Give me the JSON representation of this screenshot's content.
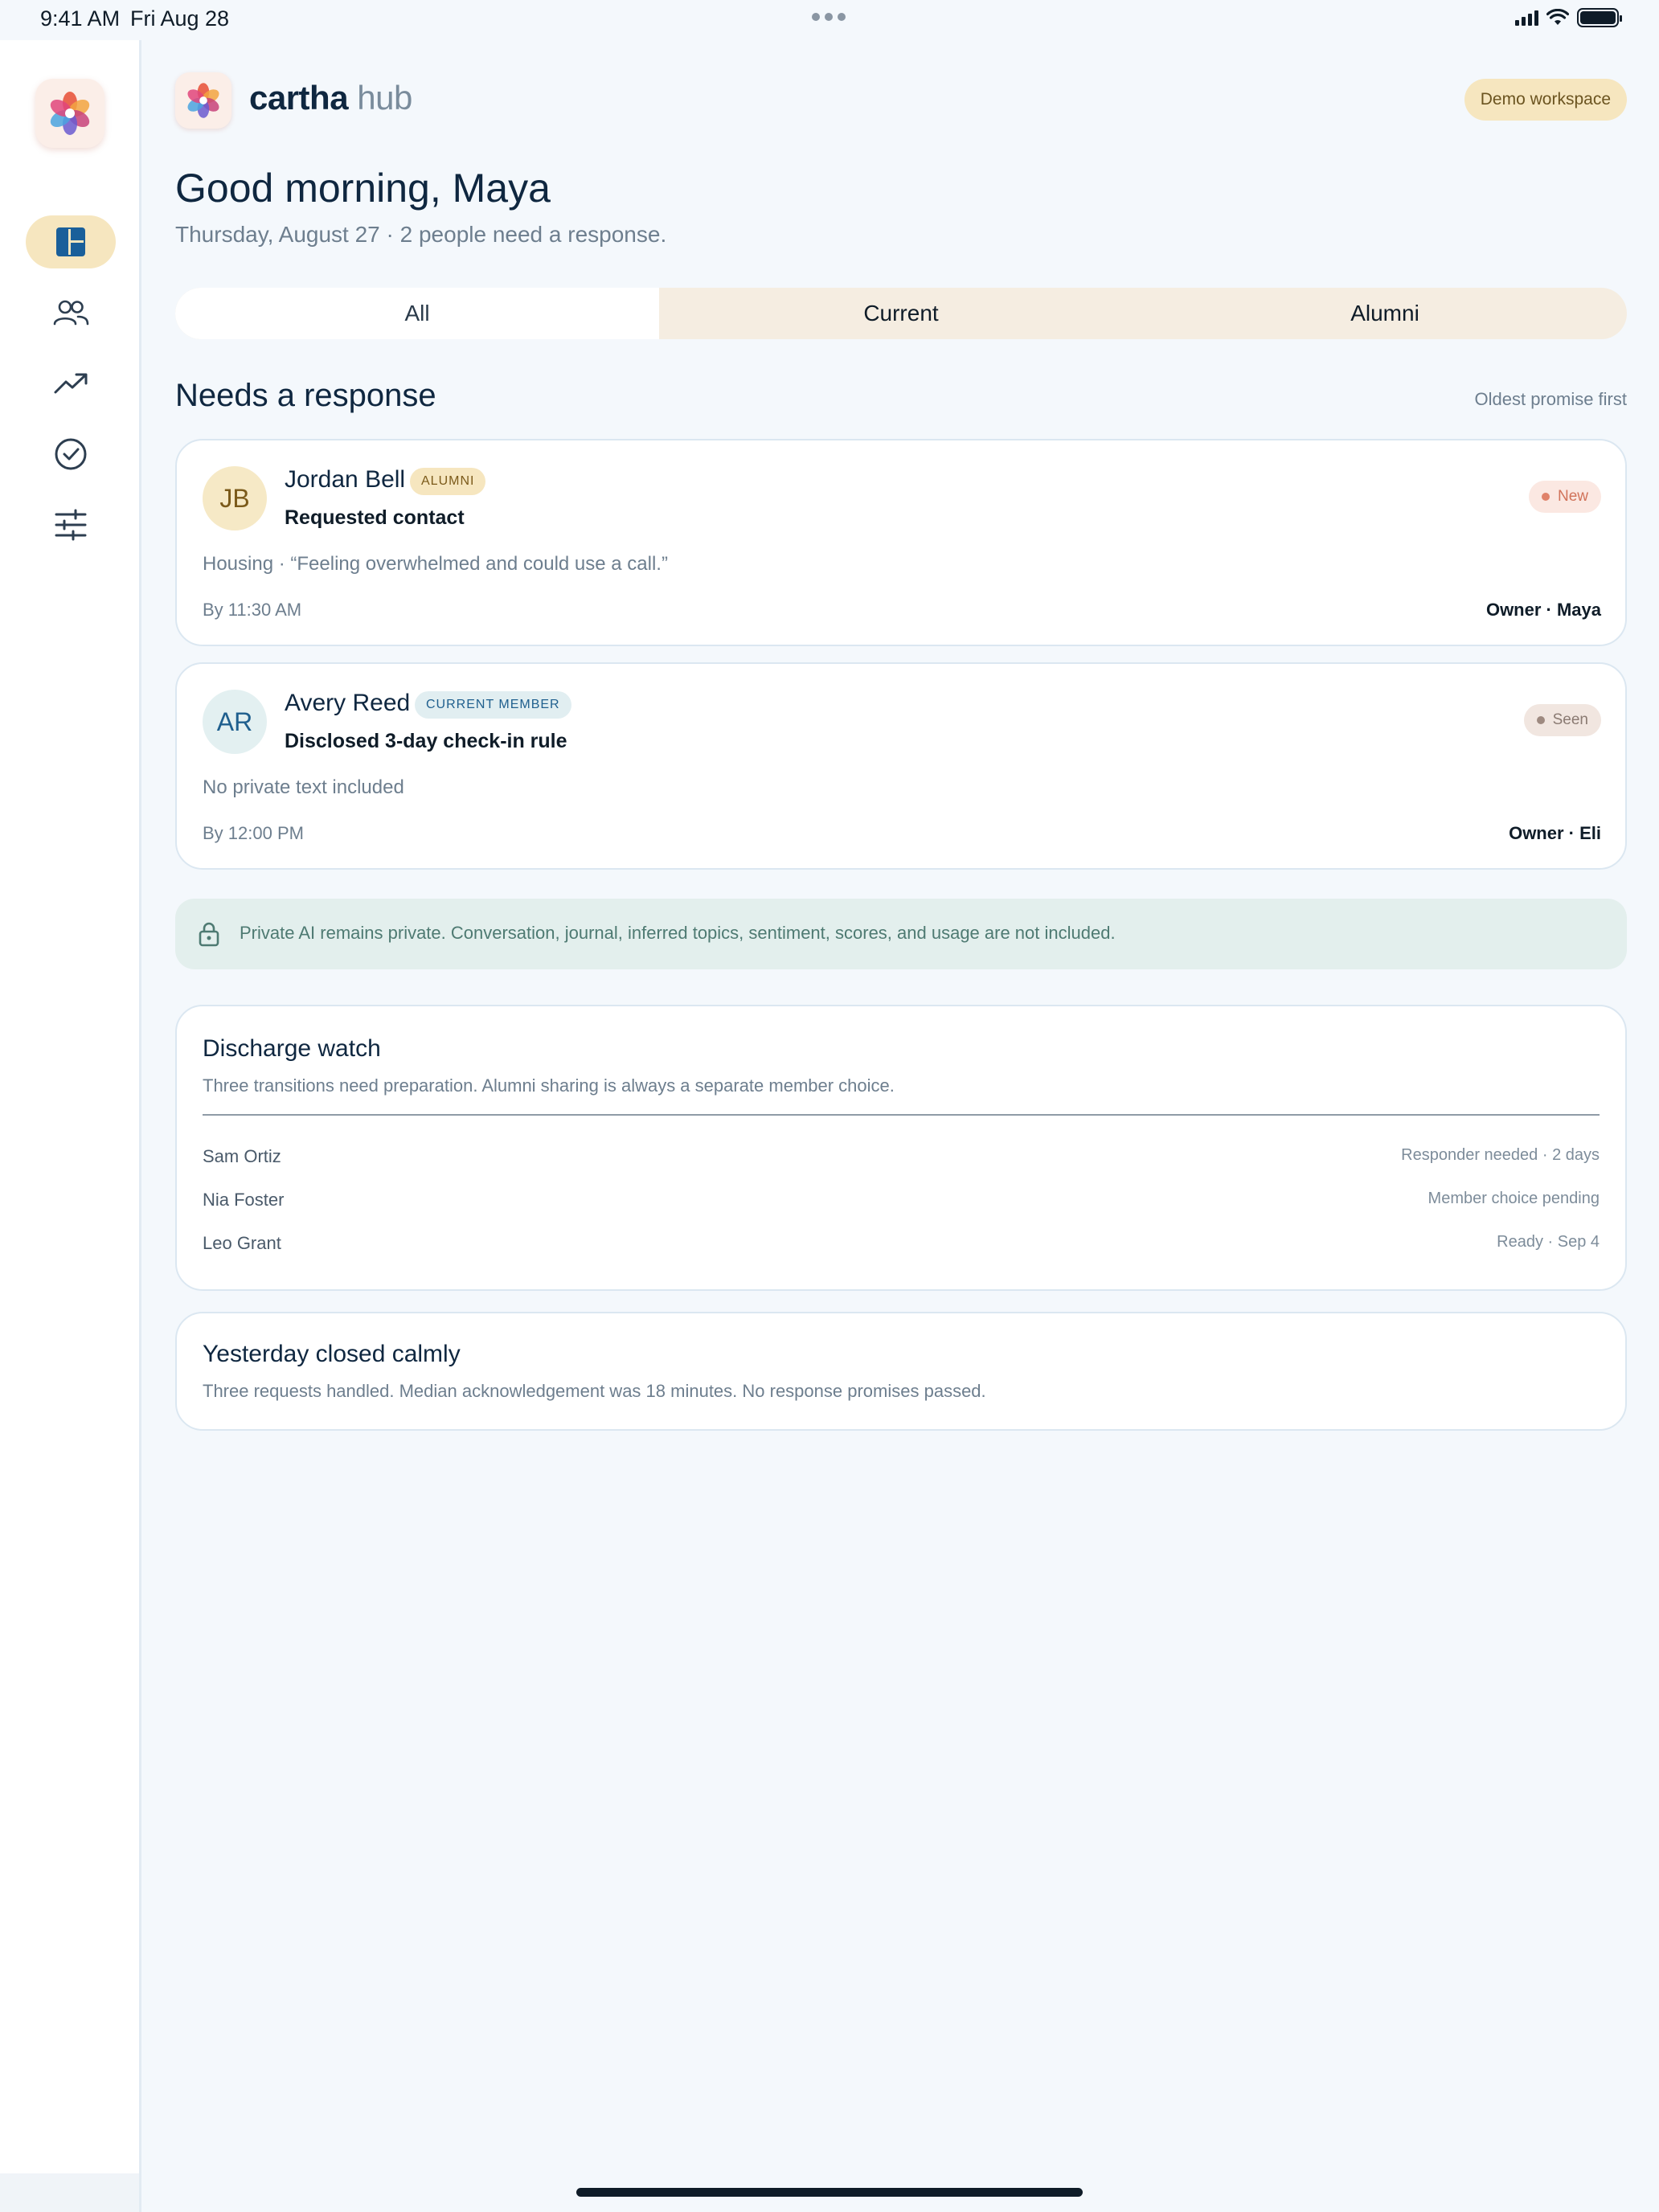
{
  "status_bar": {
    "time": "9:41 AM",
    "date": "Fri Aug 28"
  },
  "sidebar": {
    "logo_icon": "cartha-flower-logo-icon",
    "items": [
      {
        "icon": "dashboard-icon",
        "active": true
      },
      {
        "icon": "people-icon",
        "active": false
      },
      {
        "icon": "trend-up-icon",
        "active": false
      },
      {
        "icon": "check-circle-icon",
        "active": false
      },
      {
        "icon": "sliders-icon",
        "active": false
      }
    ]
  },
  "header": {
    "brand_name": "cartha",
    "brand_suffix": "hub",
    "workspace_badge": "Demo workspace"
  },
  "greeting": {
    "title": "Good morning, Maya",
    "subtitle": "Thursday, August 27 · 2 people need a response."
  },
  "tabs": [
    {
      "label": "All",
      "active": true
    },
    {
      "label": "Current",
      "active": false
    },
    {
      "label": "Alumni",
      "active": false
    }
  ],
  "needs_response": {
    "title": "Needs a response",
    "sort_label": "Oldest promise first",
    "cards": [
      {
        "initials": "JB",
        "name": "Jordan Bell",
        "tag": "ALUMNI",
        "request": "Requested contact",
        "status": "New",
        "detail": "Housing · “Feeling overwhelmed and could use a call.”",
        "due": "By 11:30 AM",
        "owner": "Owner · Maya"
      },
      {
        "initials": "AR",
        "name": "Avery Reed",
        "tag": "CURRENT MEMBER",
        "request": "Disclosed 3-day check-in rule",
        "status": "Seen",
        "detail": "No private text included",
        "due": "By 12:00 PM",
        "owner": "Owner · Eli"
      }
    ]
  },
  "privacy_notice": {
    "icon": "lock-icon",
    "text": "Private AI remains private. Conversation, journal, inferred topics, sentiment, scores, and usage are not included."
  },
  "discharge_watch": {
    "title": "Discharge watch",
    "subtitle": "Three transitions need preparation. Alumni sharing is always a separate member choice.",
    "rows": [
      {
        "name": "Sam Ortiz",
        "status": "Responder needed · 2 days"
      },
      {
        "name": "Nia Foster",
        "status": "Member choice pending"
      },
      {
        "name": "Leo Grant",
        "status": "Ready · Sep 4"
      }
    ]
  },
  "yesterday": {
    "title": "Yesterday closed calmly",
    "text": "Three requests handled. Median acknowledgement was 18 minutes. No response promises passed."
  },
  "colors": {
    "accent": "#1f5f8e",
    "active_nav": "#f6e6bf",
    "new_status": "#e0826a",
    "privacy_bg": "#e3efed"
  }
}
